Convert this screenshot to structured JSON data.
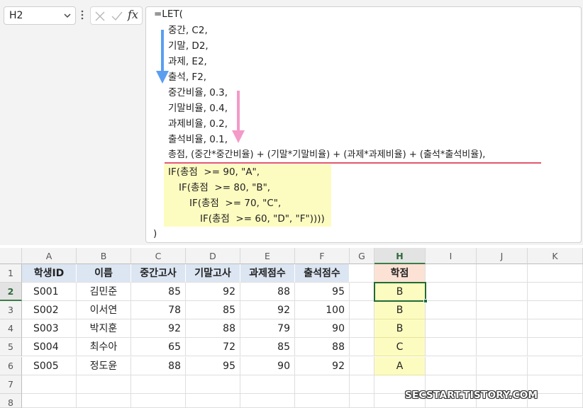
{
  "name_box": {
    "value": "H2"
  },
  "formula_bar": {
    "fx_label": "fx",
    "lines": [
      "=LET(",
      "중간, C2,",
      "기말, D2,",
      "과제, E2,",
      "출석, F2,",
      "중간비율, 0.3,",
      "기말비율, 0.4,",
      "과제비율, 0.2,",
      "출석비율, 0.1,",
      "총점, (중간*중간비율) + (기말*기말비율) + (과제*과제비율) + (출석*출석비율),",
      "IF(총점  >= 90, \"A\",",
      "IF(총점  >= 80, \"B\",",
      "IF(총점  >= 70, \"C\",",
      "IF(총점  >= 60, \"D\", \"F\"))))",
      ")"
    ]
  },
  "annotations": {
    "arrow_blue_color": "#5b9ef0",
    "arrow_pink_color": "#f39ac8",
    "underline_color": "#e4566c",
    "highlight_color": "#fdfcc0"
  },
  "grid": {
    "columns": [
      "A",
      "B",
      "C",
      "D",
      "E",
      "F",
      "G",
      "H",
      "I",
      "J",
      "K"
    ],
    "rows": [
      "1",
      "2",
      "3",
      "4",
      "5",
      "6",
      "7",
      "8"
    ],
    "headers": [
      "학생ID",
      "이름",
      "중간고사",
      "기말고사",
      "과제점수",
      "출석점수"
    ],
    "result_header": "학점",
    "records": [
      {
        "id": "S001",
        "name": "김민준",
        "mid": "85",
        "final": "92",
        "hw": "88",
        "att": "95",
        "grade": "B"
      },
      {
        "id": "S002",
        "name": "이서연",
        "mid": "78",
        "final": "85",
        "hw": "92",
        "att": "100",
        "grade": "B"
      },
      {
        "id": "S003",
        "name": "박지훈",
        "mid": "92",
        "final": "88",
        "hw": "79",
        "att": "90",
        "grade": "B"
      },
      {
        "id": "S004",
        "name": "최수아",
        "mid": "65",
        "final": "72",
        "hw": "85",
        "att": "88",
        "grade": "C"
      },
      {
        "id": "S005",
        "name": "정도윤",
        "mid": "88",
        "final": "95",
        "hw": "90",
        "att": "92",
        "grade": "A"
      }
    ],
    "header_fill": "#dce6f2",
    "result_header_fill": "#fbe2d5",
    "result_fill": "#fdfcc0",
    "active_cell": "H2"
  },
  "watermark": "SECSTART.TISTORY.COM"
}
